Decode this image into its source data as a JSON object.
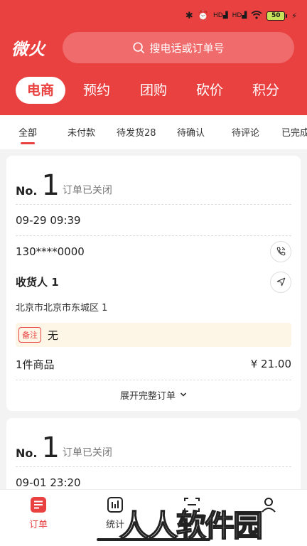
{
  "status_bar": {
    "battery": "50",
    "icons": [
      "bluetooth-icon",
      "alarm-icon",
      "hd-signal-icon",
      "hd-signal-icon",
      "wifi-icon",
      "battery-icon",
      "charging-icon"
    ]
  },
  "header": {
    "logo": "微火",
    "search_placeholder": "搜电话或订单号",
    "categories": [
      {
        "label": "电商",
        "active": true
      },
      {
        "label": "预约"
      },
      {
        "label": "团购"
      },
      {
        "label": "砍价"
      },
      {
        "label": "积分"
      }
    ]
  },
  "tabs": [
    {
      "label": "全部",
      "active": true
    },
    {
      "label": "未付款"
    },
    {
      "label": "待发货28"
    },
    {
      "label": "待确认"
    },
    {
      "label": "待评论"
    },
    {
      "label": "已完成"
    }
  ],
  "orders": [
    {
      "no_label": "No.",
      "no": "1",
      "status": "订单已关闭",
      "time": "09-29 09:39",
      "phone": "130****0000",
      "receiver": "收货人 1",
      "address": "北京市北京市东城区 1",
      "remark_tag": "备注",
      "remark": "无",
      "goods_count": "1件商品",
      "price": "¥ 21.00",
      "expand": "展开完整订单"
    },
    {
      "no_label": "No.",
      "no": "1",
      "status": "订单已关闭",
      "time": "09-01 23:20"
    }
  ],
  "bottom_nav": [
    {
      "label": "订单",
      "icon": "order-icon",
      "active": true
    },
    {
      "label": "统计",
      "icon": "stats-icon"
    },
    {
      "label": "",
      "icon": "scan-icon"
    },
    {
      "label": "",
      "icon": "user-icon"
    }
  ],
  "watermark": "人人软件园",
  "colors": {
    "brand": "#e94040",
    "remark_bg": "#fdf6e7"
  }
}
